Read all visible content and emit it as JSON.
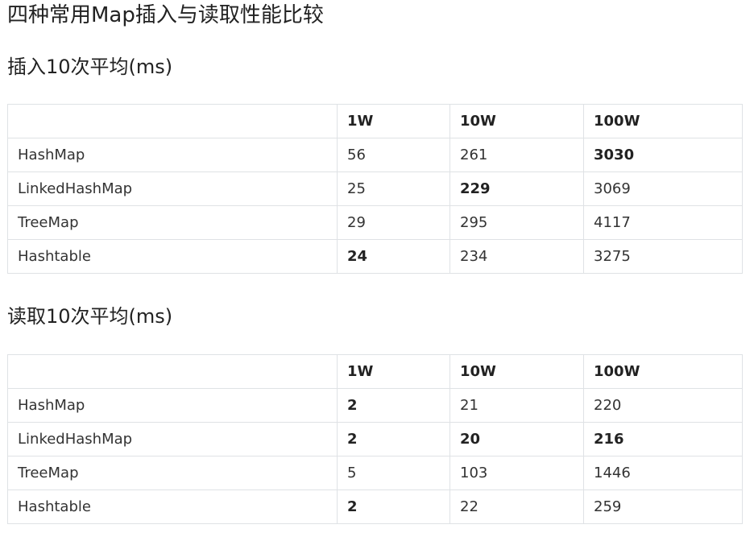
{
  "document": {
    "title": "四种常用Map插入与读取性能比较"
  },
  "insert_section": {
    "heading": "插入10次平均(ms)",
    "columns": [
      "",
      "1W",
      "10W",
      "100W"
    ],
    "rows": [
      {
        "name": "HashMap",
        "values": [
          "56",
          "261",
          "3030"
        ],
        "bold": [
          false,
          false,
          true
        ]
      },
      {
        "name": "LinkedHashMap",
        "values": [
          "25",
          "229",
          "3069"
        ],
        "bold": [
          false,
          true,
          false
        ]
      },
      {
        "name": "TreeMap",
        "values": [
          "29",
          "295",
          "4117"
        ],
        "bold": [
          false,
          false,
          false
        ]
      },
      {
        "name": "Hashtable",
        "values": [
          "24",
          "234",
          "3275"
        ],
        "bold": [
          true,
          false,
          false
        ]
      }
    ]
  },
  "read_section": {
    "heading": "读取10次平均(ms)",
    "columns": [
      "",
      "1W",
      "10W",
      "100W"
    ],
    "rows": [
      {
        "name": "HashMap",
        "values": [
          "2",
          "21",
          "220"
        ],
        "bold": [
          true,
          false,
          false
        ]
      },
      {
        "name": "LinkedHashMap",
        "values": [
          "2",
          "20",
          "216"
        ],
        "bold": [
          true,
          true,
          true
        ]
      },
      {
        "name": "TreeMap",
        "values": [
          "5",
          "103",
          "1446"
        ],
        "bold": [
          false,
          false,
          false
        ]
      },
      {
        "name": "Hashtable",
        "values": [
          "2",
          "22",
          "259"
        ],
        "bold": [
          true,
          false,
          false
        ]
      }
    ]
  }
}
